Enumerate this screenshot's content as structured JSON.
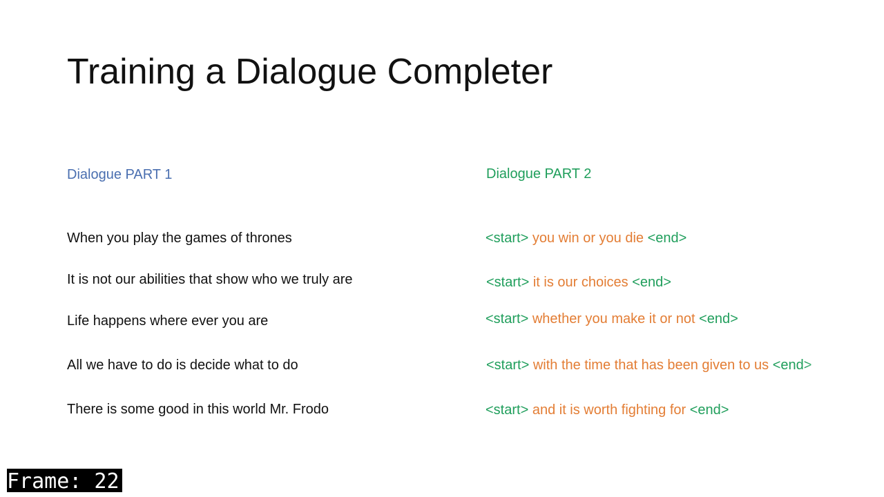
{
  "slide": {
    "title": "Training a Dialogue Completer",
    "part1_heading": "Dialogue PART 1",
    "part2_heading": "Dialogue PART 2",
    "rows": [
      {
        "prompt": "When you play the games of thrones",
        "start_token": "<start>",
        "reply": "you win or you die",
        "end_token": "<end>"
      },
      {
        "prompt": "It is not our abilities that show who we truly are",
        "start_token": "<start>",
        "reply": "it is our choices",
        "end_token": "<end>"
      },
      {
        "prompt": "Life happens where ever you are",
        "start_token": "<start>",
        "reply": "whether you make it or not",
        "end_token": "<end>"
      },
      {
        "prompt": "All we have to do is decide what to do",
        "start_token": "<start>",
        "reply": "with the time that has been given to us",
        "end_token": "<end>"
      },
      {
        "prompt": "There is some good in this world Mr. Frodo",
        "start_token": "<start>",
        "reply": "and it is worth fighting for",
        "end_token": "<end>"
      }
    ]
  },
  "overlay": {
    "frame_label": "Frame: 22"
  },
  "colors": {
    "part1_heading": "#4a6fb0",
    "token": "#1f9e5b",
    "reply": "#e37d34",
    "text": "#111111"
  }
}
